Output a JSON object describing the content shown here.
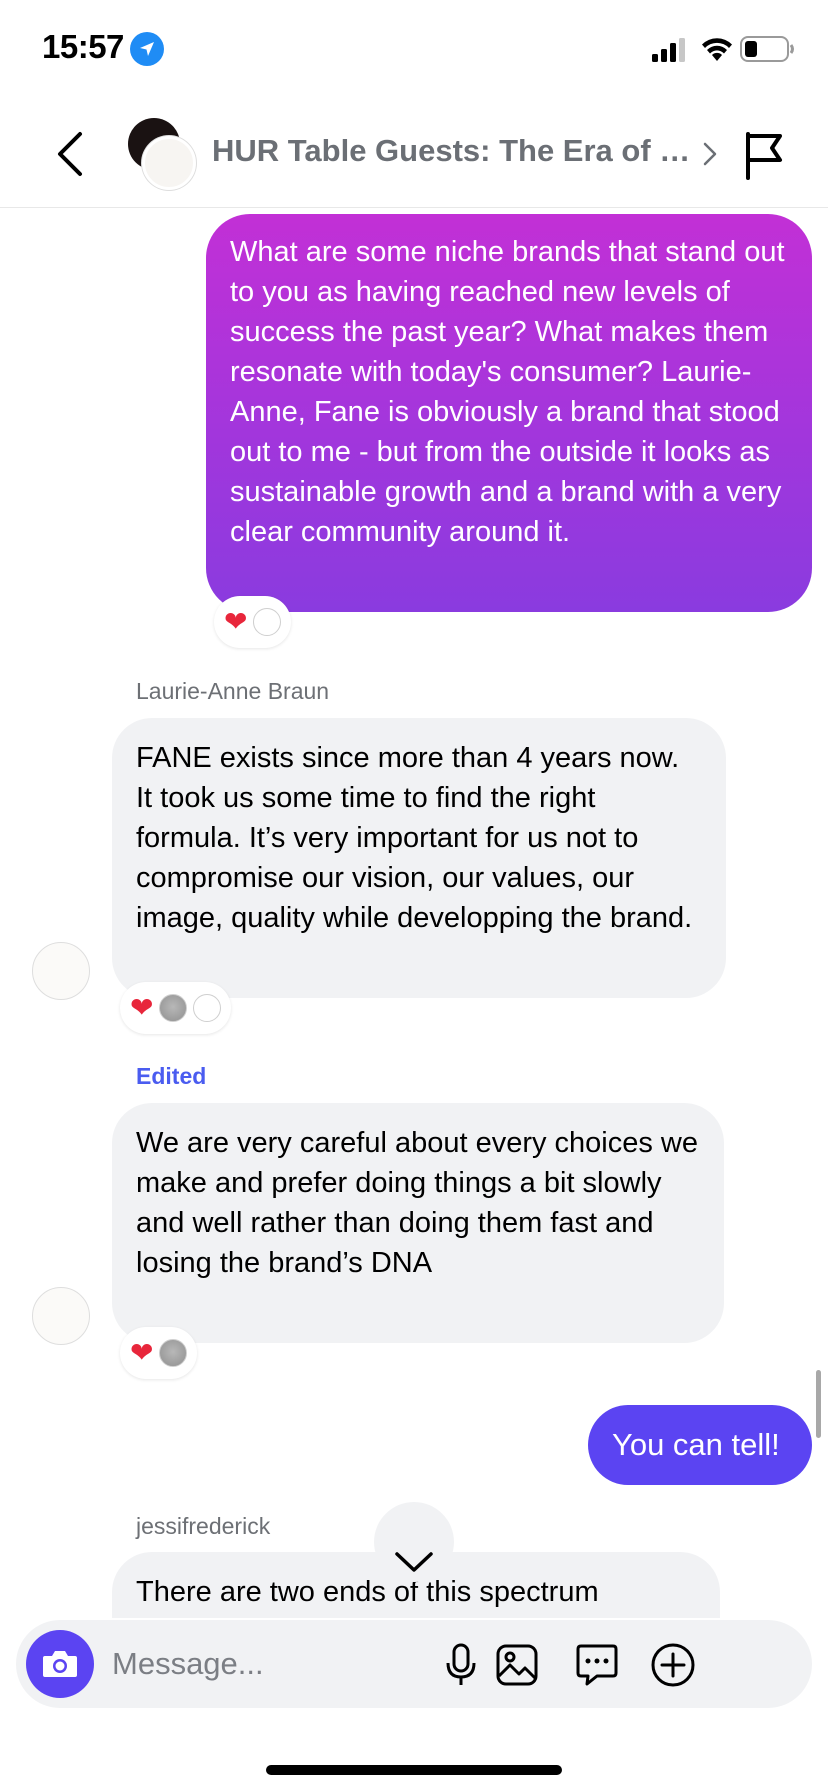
{
  "status_bar": {
    "time": "15:57",
    "icons": [
      "location-arrow-icon",
      "signal-icon",
      "wifi-icon",
      "battery-icon"
    ]
  },
  "header": {
    "title": "HUR Table Guests: The Era of Niche Brands",
    "icons": [
      "chevron-left-icon",
      "chevron-right-icon",
      "flag-icon"
    ]
  },
  "messages": [
    {
      "direction": "outgoing",
      "text": "What are some niche brands that stand out to you as having reached new levels of success the past year? What makes them resonate with today's consumer? Laurie-Anne, Fane is obviously a brand that stood out to me - but from the outside it looks as sustainable growth and a brand with a very clear community around it.",
      "reactions": [
        "heart",
        "avatar"
      ]
    },
    {
      "direction": "incoming",
      "sender": "Laurie-Anne Braun",
      "text": "FANE exists since more than 4 years now. It took us some time to find the right formula. It’s very important for us not to compromise our vision, our values, our image, quality while developping the brand.",
      "reactions": [
        "heart",
        "avatar",
        "avatar"
      ]
    },
    {
      "direction": "incoming",
      "label": "Edited",
      "text": "We are very careful about every choices we make and prefer doing things a bit slowly and well rather than doing them fast and losing the brand’s DNA",
      "reactions": [
        "heart",
        "avatar"
      ]
    },
    {
      "direction": "outgoing",
      "text": "You can tell!"
    },
    {
      "direction": "incoming",
      "sender": "jessifrederick",
      "text": "There are two ends of this spectrum"
    }
  ],
  "reaction_symbols": {
    "heart": "❤"
  },
  "composer": {
    "placeholder": "Message...",
    "icons": [
      "camera-icon",
      "microphone-icon",
      "gallery-icon",
      "sticker-chat-icon",
      "plus-circle-icon"
    ]
  },
  "colors": {
    "outgoing_gradient_top": "#c230d6",
    "outgoing_gradient_bottom": "#8a3bdf",
    "outgoing_solid": "#5b44f2",
    "incoming_bubble": "#f1f2f4",
    "edited_label": "#4a5cf0"
  }
}
